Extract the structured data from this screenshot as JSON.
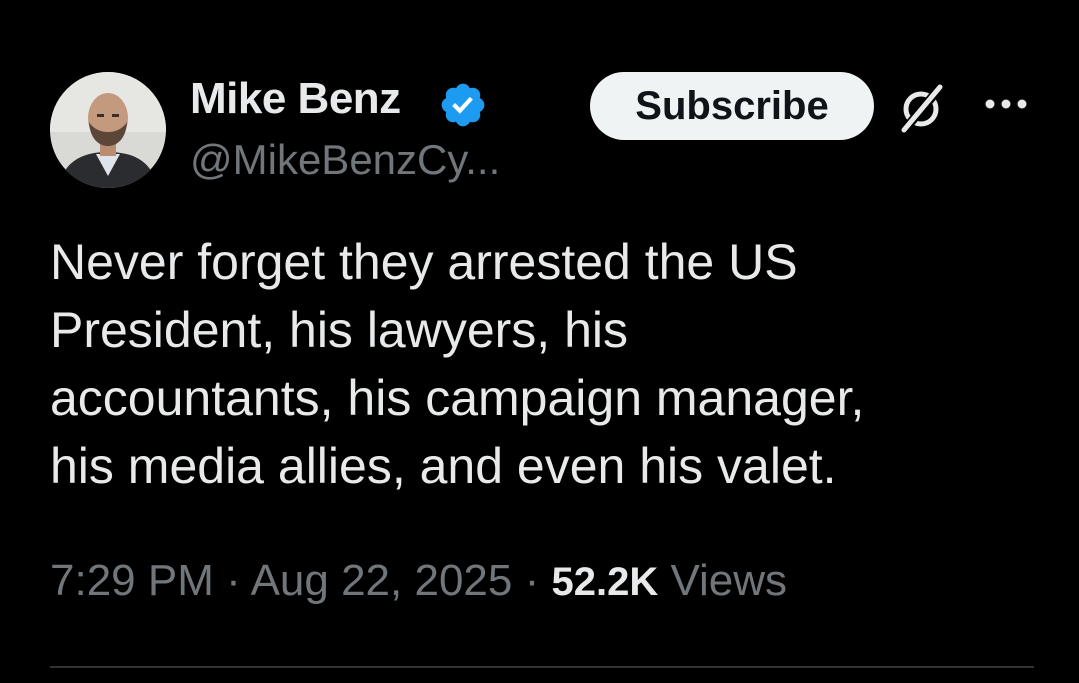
{
  "author": {
    "display_name": "Mike Benz",
    "handle": "@MikeBenzCy...",
    "verified": true,
    "verified_color": "#1d9bf0"
  },
  "actions": {
    "subscribe_label": "Subscribe",
    "grok_icon": "grok-icon",
    "more_icon": "more-horizontal-icon"
  },
  "tweet": {
    "lines": [
      "Never forget they arrested the US",
      "President, his lawyers, his",
      "accountants, his campaign manager,",
      "his media allies, and even his valet."
    ]
  },
  "meta": {
    "time": "7:29 PM",
    "separator": " · ",
    "date": "Aug 22, 2025",
    "views_count": "52.2K",
    "views_label": "Views"
  },
  "colors": {
    "background": "#000000",
    "primary_text": "#e7e9ea",
    "secondary_text": "#71767b",
    "button_bg": "#eff3f4",
    "divider": "#2f3336"
  }
}
